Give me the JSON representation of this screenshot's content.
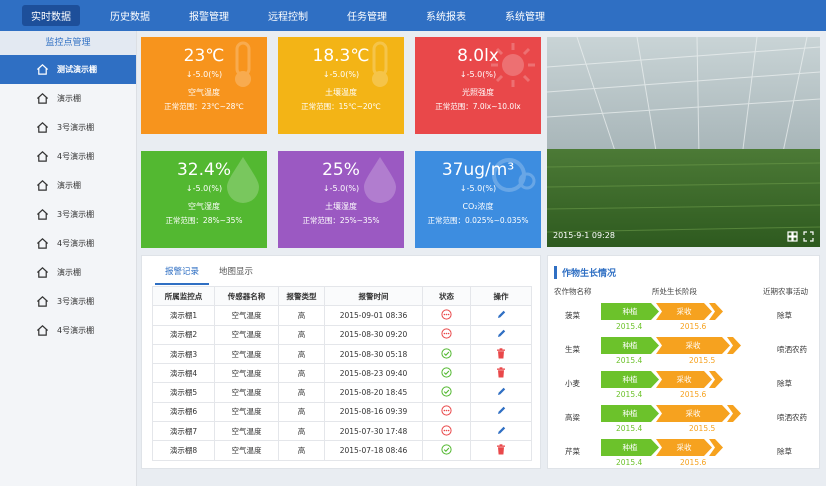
{
  "nav": {
    "items": [
      "实时数据",
      "历史数据",
      "报警管理",
      "远程控制",
      "任务管理",
      "系统报表",
      "系统管理"
    ]
  },
  "sidebar": {
    "title": "监控点管理",
    "items": [
      "测试演示棚",
      "演示棚",
      "3号演示棚",
      "4号演示棚",
      "演示棚",
      "3号演示棚",
      "4号演示棚",
      "演示棚",
      "3号演示棚",
      "4号演示棚"
    ]
  },
  "metrics": {
    "air_temp": {
      "value": "23℃",
      "change": "↓-5.0(%)",
      "label": "空气温度",
      "range": "正常范围：23℃~28℃",
      "color": "#f7941d"
    },
    "soil_temp": {
      "value": "18.3℃",
      "change": "↓-5.0(%)",
      "label": "土壤温度",
      "range": "正常范围：15℃~20℃",
      "color": "#f3b416"
    },
    "light": {
      "value": "8.0lx",
      "change": "↓-5.0(%)",
      "label": "光照强度",
      "range": "正常范围：7.0lx~10.0lx",
      "color": "#e9484a"
    },
    "air_hum": {
      "value": "32.4%",
      "change": "↓-5.0(%)",
      "label": "空气湿度",
      "range": "正常范围：28%~35%",
      "color": "#53b831"
    },
    "soil_hum": {
      "value": "25%",
      "change": "↓-5.0(%)",
      "label": "土壤湿度",
      "range": "正常范围：25%~35%",
      "color": "#9b59c2"
    },
    "co2": {
      "value": "37ug/m³",
      "change": "↓-5.0(%)",
      "label": "CO₂浓度",
      "range": "正常范围：0.025%~0.035%",
      "color": "#3d8de0"
    }
  },
  "camera": {
    "timestamp": "2015-9-1   09:28"
  },
  "alarm": {
    "tabs": [
      "报警记录",
      "地图显示"
    ],
    "columns": [
      "所属监控点",
      "传感器名称",
      "报警类型",
      "报警时间",
      "状态",
      "操作"
    ],
    "rows": [
      {
        "point": "演示棚1",
        "sensor": "空气温度",
        "type": "高",
        "time": "2015-09-01  08:36",
        "status": "pending",
        "action": "edit"
      },
      {
        "point": "演示棚2",
        "sensor": "空气温度",
        "type": "高",
        "time": "2015-08-30  09:20",
        "status": "pending",
        "action": "edit"
      },
      {
        "point": "演示棚3",
        "sensor": "空气温度",
        "type": "高",
        "time": "2015-08-30  05:18",
        "status": "done",
        "action": "delete"
      },
      {
        "point": "演示棚4",
        "sensor": "空气温度",
        "type": "高",
        "time": "2015-08-23  09:40",
        "status": "done",
        "action": "delete"
      },
      {
        "point": "演示棚5",
        "sensor": "空气温度",
        "type": "高",
        "time": "2015-08-20  18:45",
        "status": "done",
        "action": "edit"
      },
      {
        "point": "演示棚6",
        "sensor": "空气温度",
        "type": "高",
        "time": "2015-08-16  09:39",
        "status": "pending",
        "action": "edit"
      },
      {
        "point": "演示棚7",
        "sensor": "空气温度",
        "type": "高",
        "time": "2015-07-30  17:48",
        "status": "pending",
        "action": "edit"
      },
      {
        "point": "演示棚8",
        "sensor": "空气温度",
        "type": "高",
        "time": "2015-07-18  08:46",
        "status": "done",
        "action": "delete"
      }
    ]
  },
  "growth": {
    "title": "作物生长情况",
    "headers": [
      "农作物名称",
      "所处生长阶段",
      "近期农事活动"
    ],
    "stage1": "种植",
    "stage2": "采收",
    "rows": [
      {
        "crop": "菠菜",
        "date1": "2015.4",
        "date2": "2015.6",
        "activity": "除草"
      },
      {
        "crop": "生菜",
        "date1": "2015.4",
        "date2": "2015.5",
        "activity": "喷洒农药"
      },
      {
        "crop": "小麦",
        "date1": "2015.4",
        "date2": "2015.6",
        "activity": "除草"
      },
      {
        "crop": "高粱",
        "date1": "2015.4",
        "date2": "2015.5",
        "activity": "喷洒农药"
      },
      {
        "crop": "芹菜",
        "date1": "2015.4",
        "date2": "2015.6",
        "activity": "除草"
      }
    ]
  }
}
